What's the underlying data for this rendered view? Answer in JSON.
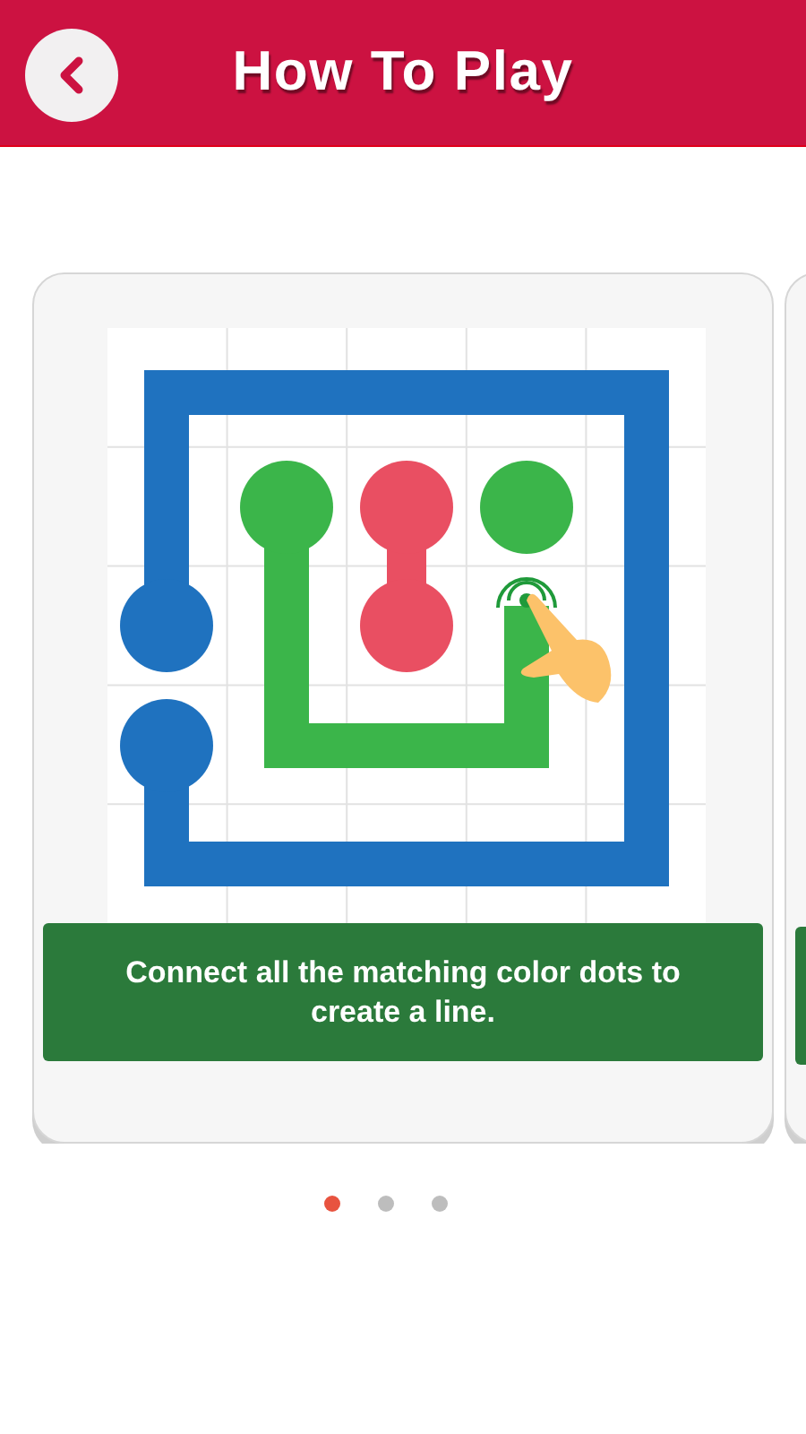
{
  "header": {
    "title": "How To Play"
  },
  "slides": [
    {
      "text": "Connect all the matching color dots to create a line."
    }
  ],
  "pagination": [
    {
      "selected": true
    },
    {
      "selected": false
    },
    {
      "selected": false
    }
  ]
}
